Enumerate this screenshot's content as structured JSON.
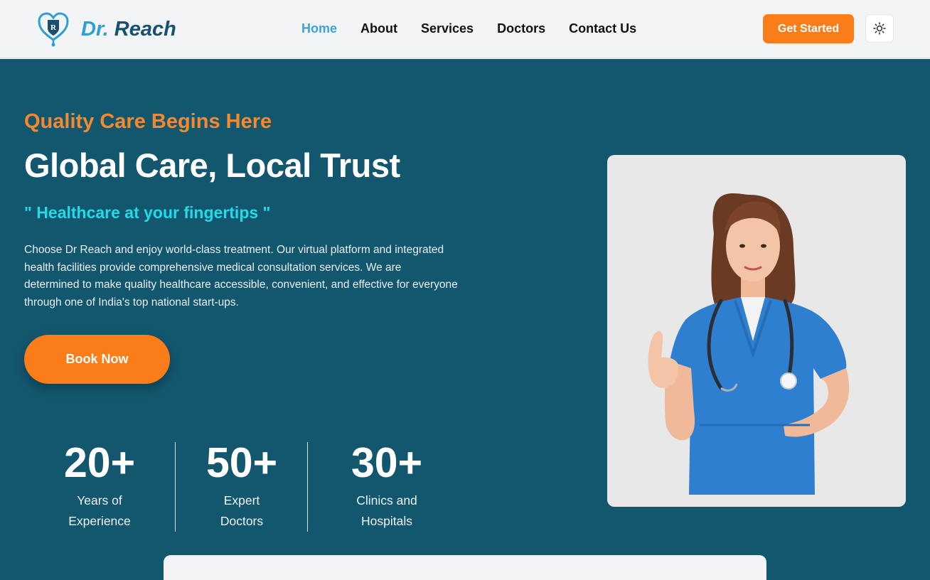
{
  "brand": {
    "name_prefix": "Dr.",
    "name_suffix": "Reach",
    "logo_icon": "heart-stethoscope-logo"
  },
  "nav": {
    "items": [
      {
        "label": "Home",
        "active": true
      },
      {
        "label": "About",
        "active": false
      },
      {
        "label": "Services",
        "active": false
      },
      {
        "label": "Doctors",
        "active": false
      },
      {
        "label": "Contact Us",
        "active": false
      }
    ]
  },
  "header": {
    "cta_label": "Get Started",
    "theme_icon": "sun-icon"
  },
  "hero": {
    "tagline": "Quality Care Begins Here",
    "headline": "Global Care, Local Trust",
    "subhead": "\" Healthcare at your fingertips \"",
    "description": "Choose Dr Reach and enjoy world-class treatment. Our virtual platform and integrated health facilities provide comprehensive medical consultation services. We are determined to make quality healthcare accessible, convenient, and effective for everyone through one of India's top national start-ups.",
    "book_label": "Book Now"
  },
  "stats": [
    {
      "value": "20+",
      "line1": "Years of",
      "line2": "Experience"
    },
    {
      "value": "50+",
      "line1": "Expert",
      "line2": "Doctors"
    },
    {
      "value": "30+",
      "line1": "Clinics and",
      "line2": "Hospitals"
    }
  ],
  "colors": {
    "hero_bg": "#13576f",
    "accent_orange": "#fa7d19",
    "subhead_cyan": "#21dbe8",
    "nav_active": "#3ea2d8"
  }
}
